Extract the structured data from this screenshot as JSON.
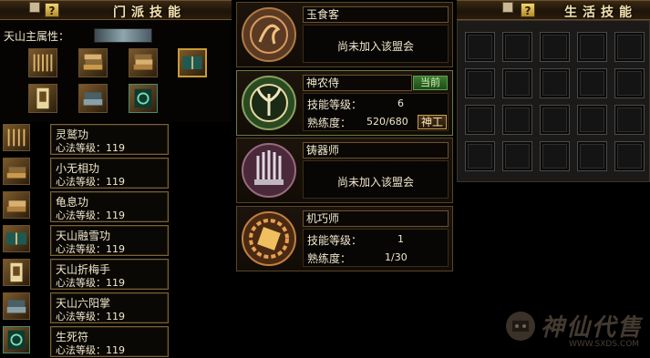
{
  "header": {
    "left_help": "?",
    "left_title": "门派技能",
    "right_help": "?",
    "right_title": "生活技能"
  },
  "sect": {
    "attribute_label": "天山主属性：",
    "skills": [
      {
        "name": "灵鹫功",
        "level": "心法等级：119",
        "icon": "scroll-bundle-icon"
      },
      {
        "name": "小无相功",
        "level": "心法等级：119",
        "icon": "book-stack-icon"
      },
      {
        "name": "龟息功",
        "level": "心法等级：119",
        "icon": "book-stack-icon"
      },
      {
        "name": "天山融雪功",
        "level": "心法等级：119",
        "icon": "open-book-icon"
      },
      {
        "name": "天山折梅手",
        "level": "心法等级：119",
        "icon": "scroll-icon"
      },
      {
        "name": "天山六阳掌",
        "level": "心法等级：119",
        "icon": "book-stack-icon"
      },
      {
        "name": "生死符",
        "level": "心法等级：119",
        "icon": "talisman-icon"
      }
    ]
  },
  "life_skills": {
    "cards": [
      {
        "title": "玉食客",
        "message": "尚未加入该盟会",
        "emblem": "dragon-emblem-icon"
      },
      {
        "title": "神农侍",
        "current": "当前",
        "skill_level_label": "技能等级：",
        "skill_level": "6",
        "proficiency_label": "熟练度：",
        "proficiency": "520/680",
        "upgrade_button": "神工",
        "emblem": "herb-emblem-icon"
      },
      {
        "title": "铸器师",
        "message": "尚未加入该盟会",
        "emblem": "forge-emblem-icon"
      },
      {
        "title": "机巧师",
        "skill_level_label": "技能等级：",
        "skill_level": "1",
        "proficiency_label": "熟练度：",
        "proficiency": "1/30",
        "emblem": "gear-emblem-icon"
      }
    ],
    "slot_rows": 4,
    "slot_cols": 5
  },
  "watermark": {
    "text": "神仙代售",
    "url": "WWW.SXDS.COM"
  }
}
